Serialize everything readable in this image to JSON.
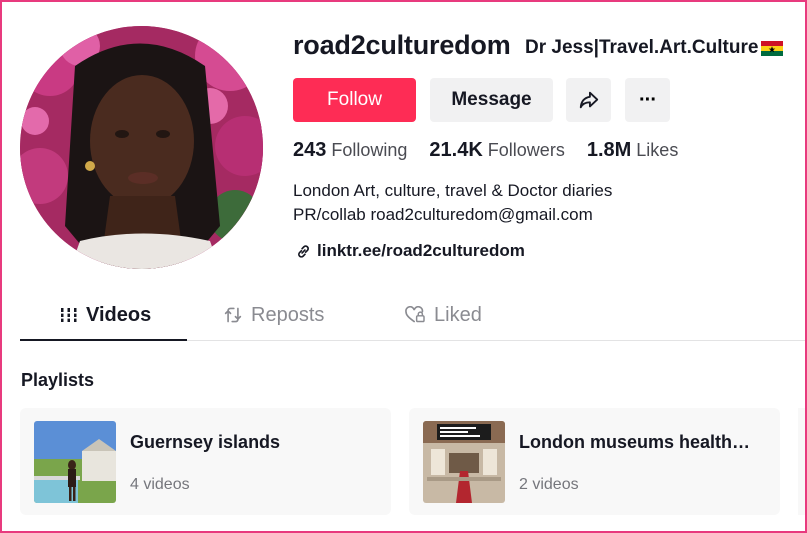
{
  "profile": {
    "username": "road2culturedom",
    "nickname": "Dr Jess|Travel.Art.Culture",
    "avatar_icon": "profile-photo",
    "flag_icon": "ghana-flag-icon"
  },
  "actions": {
    "follow_label": "Follow",
    "message_label": "Message",
    "share_icon": "share-arrow-icon",
    "more_icon": "more-dots-icon",
    "more_glyph": "···"
  },
  "stats": [
    {
      "value": "243",
      "label": "Following"
    },
    {
      "value": "21.4K",
      "label": "Followers"
    },
    {
      "value": "1.8M",
      "label": "Likes"
    }
  ],
  "bio": {
    "line1": "London Art, culture, travel & Doctor diaries",
    "line2": "PR/collab road2culturedom@gmail.com"
  },
  "link": {
    "icon": "link-icon",
    "text": "linktr.ee/road2culturedom"
  },
  "tabs": [
    {
      "label": "Videos",
      "icon": "grid-bars-icon",
      "active": true
    },
    {
      "label": "Reposts",
      "icon": "repost-icon",
      "active": false
    },
    {
      "label": "Liked",
      "icon": "heart-lock-icon",
      "active": false
    }
  ],
  "playlists": {
    "title": "Playlists",
    "items": [
      {
        "title": "Guernsey islands",
        "count": "4 videos"
      },
      {
        "title": "London museums health…",
        "count": "2 videos"
      }
    ]
  },
  "colors": {
    "accent": "#fe2c55",
    "border": "#e83a7e",
    "text": "#161823",
    "muted": "#8a8b91"
  }
}
